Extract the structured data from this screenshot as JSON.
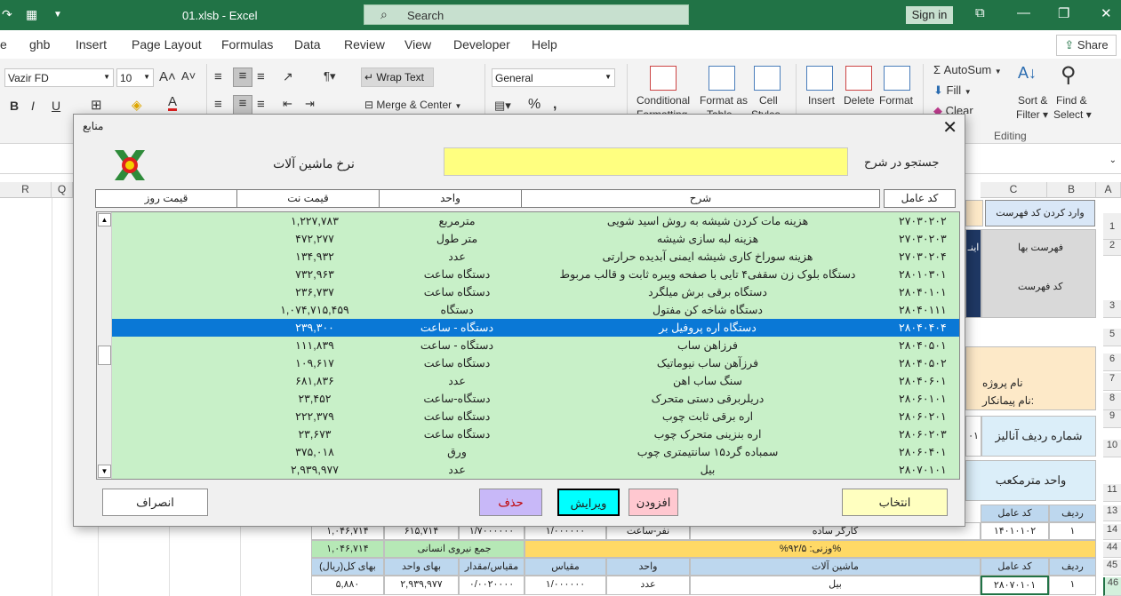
{
  "titlebar": {
    "filename": "01.xlsb  -  Excel",
    "search_placeholder": "Search",
    "signin": "Sign in"
  },
  "tabs": [
    "e",
    "ghb",
    "Insert",
    "Page Layout",
    "Formulas",
    "Data",
    "Review",
    "View",
    "Developer",
    "Help"
  ],
  "share": "Share",
  "ribbon": {
    "font_name": "Vazir FD",
    "font_size": "10",
    "wrap_text": "Wrap Text",
    "merge_center": "Merge & Center",
    "number_format": "General",
    "conditional": "Conditional",
    "conditional2": "Formatting",
    "format_as": "Format as",
    "format_as2": "Table",
    "cell": "Cell",
    "cell2": "Styles",
    "insert": "Insert",
    "delete": "Delete",
    "format": "Format",
    "autosum": "AutoSum",
    "fill": "Fill",
    "clear": "Clear",
    "sort": "Sort &",
    "sort2": "Filter",
    "find": "Find &",
    "find2": "Select",
    "editing": "Editing",
    "bold": "B",
    "italic": "I",
    "underline": "U"
  },
  "sheet": {
    "col_headers_left": [
      "R",
      "Q"
    ],
    "col_headers_right": [
      "C",
      "B",
      "A"
    ],
    "row_numbers": [
      "1",
      "2",
      "3",
      "5",
      "6",
      "7",
      "8",
      "9",
      "10",
      "11",
      "13",
      "14",
      "44",
      "45",
      "46"
    ],
    "cells": {
      "btn_enter_code": "وارد کردن کد فهرست",
      "price_list": "فهرست بها",
      "list_code": "کد فهرست",
      "project_name": "نام پروژه",
      "contractor": "نام پیمانکار:",
      "analysis_row": "شماره ردیف آنالیز",
      "unit": "واحد  مترمکعب",
      "row_hdr": "ردیف",
      "agent_code_hdr": "کد عامل",
      "r14_row": "۱",
      "r14_code": "۱۴۰۱۰۱۰۲",
      "r14_desc": "کارگر ساده",
      "r14_unit": "نفر-ساعت",
      "r14_scale": "۱/۰۰۰۰۰۰",
      "r14_qty": "۱/۷۰۰۰۰۰۰",
      "r14_price": "۶۱۵,۷۱۴",
      "r14_total": "۱,۰۴۶,۷۱۴",
      "weight": "%وزنی: ۹۲/۵%",
      "sum_label": "جمع  نیروی انسانی",
      "sum_val": "۱,۰۴۶,۷۱۴",
      "h_row": "ردیف",
      "h_code": "کد عامل",
      "h_machine": "ماشین  آلات",
      "h_unit": "واحد",
      "h_scale": "مقیاس",
      "h_qty": "مقیاس/مقدار",
      "h_price": "بهای واحد",
      "h_total": "بهای کل(ریال)",
      "r46_row": "۱",
      "r46_code": "۲۸۰۷۰۱۰۱",
      "r46_desc": "بیل",
      "r46_unit": "عدد",
      "r46_scale": "۱/۰۰۰۰۰۰",
      "r46_qty": "۰/۰۰۲۰۰۰۰",
      "r46_price": "۲,۹۳۹,۹۷۷",
      "r46_total": "۵,۸۸۰",
      "partial_c": "۰۱",
      "partial_d": "اینـ"
    }
  },
  "dialog": {
    "title": "منابع",
    "heading": "نرخ ماشین آلات",
    "search_label": "جستجو در شرح",
    "search_value": "",
    "columns": {
      "code": "کد عامل",
      "desc": "شرح",
      "unit": "واحد",
      "net_price": "قیمت نت",
      "day_price": "قیمت روز"
    },
    "rows": [
      {
        "code": "۲۷۰۳۰۲۰۲",
        "desc": "هزینه مات کردن شیشه به روش اسید شویی",
        "unit": "مترمربع",
        "price": "۱,۲۲۷,۷۸۳"
      },
      {
        "code": "۲۷۰۳۰۲۰۳",
        "desc": "هزینه لبه سازی شیشه",
        "unit": "متر طول",
        "price": "۴۷۲,۲۷۷"
      },
      {
        "code": "۲۷۰۳۰۲۰۴",
        "desc": "هزینه سوراخ کاری شیشه ایمنی آبدیده حرارتی",
        "unit": "عدد",
        "price": "۱۳۴,۹۳۲"
      },
      {
        "code": "۲۸۰۱۰۳۰۱",
        "desc": "دستگاه بلوک زن سقفی۴ تایی با صفحه ویبره ثابت و قالب مربوط",
        "unit": "دستگاه ساعت",
        "price": "۷۳۲,۹۶۳"
      },
      {
        "code": "۲۸۰۴۰۱۰۱",
        "desc": "دستگاه برقی برش میلگرد",
        "unit": "دستگاه ساعت",
        "price": "۲۳۶,۷۳۷"
      },
      {
        "code": "۲۸۰۴۰۱۱۱",
        "desc": "دستگاه شاخه کن مفتول",
        "unit": "دستگاه",
        "price": "۱,۰۷۴,۷۱۵,۴۵۹"
      },
      {
        "code": "۲۸۰۴۰۴۰۴",
        "desc": "دستگاه اره پروفیل بر",
        "unit": "دستگاه -  ساعت",
        "price": "۲۳۹,۳۰۰",
        "selected": true
      },
      {
        "code": "۲۸۰۴۰۵۰۱",
        "desc": "فرزاهن ساب",
        "unit": "دستگاه -  ساعت",
        "price": "۱۱۱,۸۳۹"
      },
      {
        "code": "۲۸۰۴۰۵۰۲",
        "desc": "فرزآهن ساب نیوماتیک",
        "unit": "دستگاه ساعت",
        "price": "۱۰۹,۶۱۷"
      },
      {
        "code": "۲۸۰۴۰۶۰۱",
        "desc": "سنگ ساب اهن",
        "unit": "عدد",
        "price": "۶۸۱,۸۳۶"
      },
      {
        "code": "۲۸۰۶۰۱۰۱",
        "desc": "دریلربرقی دستی متحرک",
        "unit": "دستگاه-ساعت",
        "price": "۲۳,۴۵۲"
      },
      {
        "code": "۲۸۰۶۰۲۰۱",
        "desc": "اره برقی ثابت چوب",
        "unit": "دستگاه ساعت",
        "price": "۲۲۲,۳۷۹"
      },
      {
        "code": "۲۸۰۶۰۲۰۳",
        "desc": "اره بنزینی متحرک چوب",
        "unit": "دستگاه ساعت",
        "price": "۲۳,۶۷۳"
      },
      {
        "code": "۲۸۰۶۰۴۰۱",
        "desc": "سمباده گرد۱۵ سانتیمتری چوب",
        "unit": "ورق",
        "price": "۳۷۵,۰۱۸"
      },
      {
        "code": "۲۸۰۷۰۱۰۱",
        "desc": "بیل",
        "unit": "عدد",
        "price": "۲,۹۳۹,۹۷۷"
      }
    ],
    "buttons": {
      "select": "انتخاب",
      "add": "افزودن",
      "edit": "ویرایش",
      "delete": "حذف",
      "cancel": "انصراف"
    }
  },
  "colors": {
    "excel_green": "#217346",
    "list_bg": "#c8f0c8",
    "selection": "#0a78d6",
    "search_bg": "#ffff80"
  }
}
